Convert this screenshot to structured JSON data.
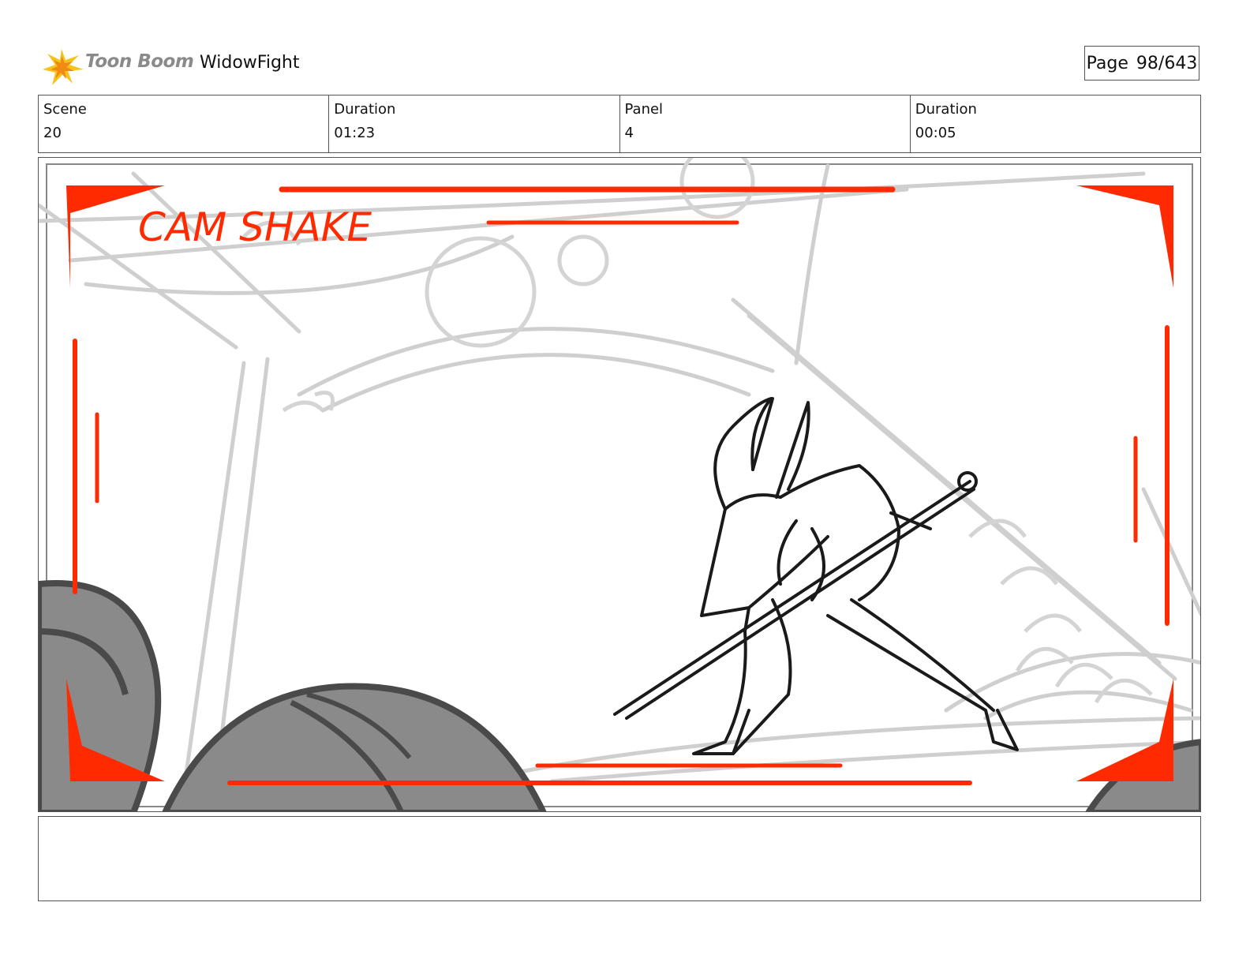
{
  "header": {
    "brand": "Toon Boom",
    "project_title": "WidowFight",
    "page_label": "Page",
    "page_value": "98/643"
  },
  "info": {
    "scene_label": "Scene",
    "scene_value": "20",
    "scene_duration_label": "Duration",
    "scene_duration_value": "01:23",
    "panel_label": "Panel",
    "panel_value": "4",
    "panel_duration_label": "Duration",
    "panel_duration_value": "00:05"
  },
  "panel": {
    "annotation": "CAM SHAKE",
    "accent_color": "#ff2a00"
  },
  "notes": {
    "text": ""
  }
}
